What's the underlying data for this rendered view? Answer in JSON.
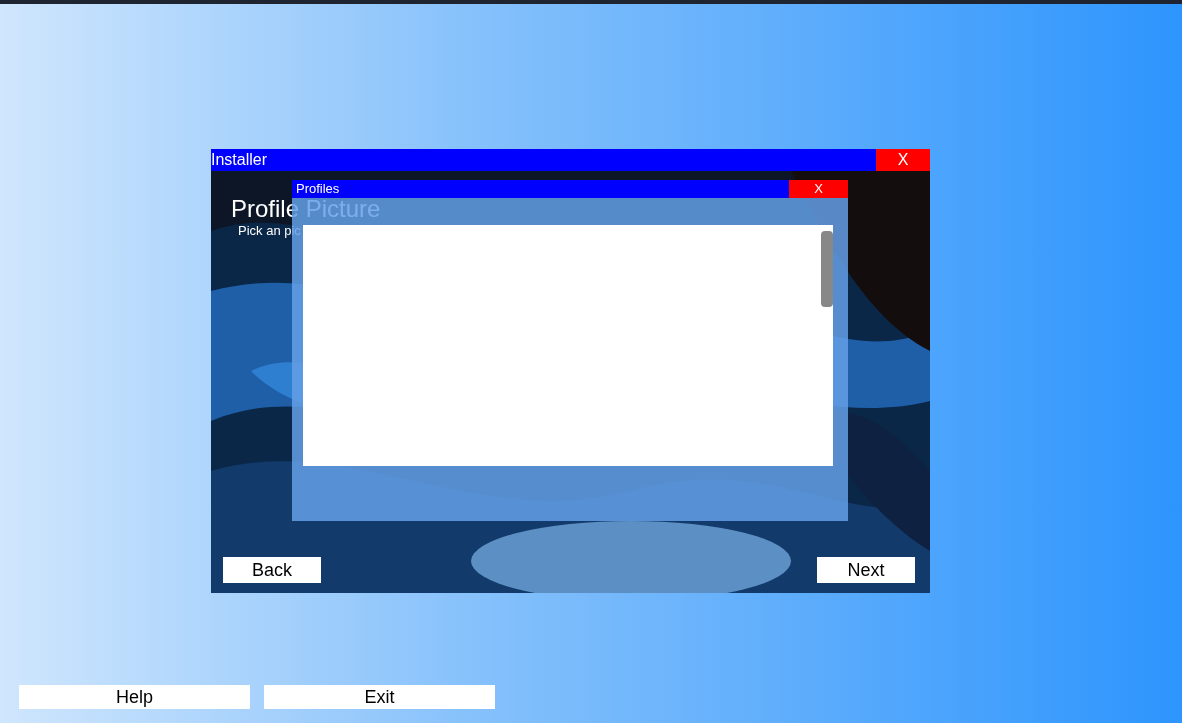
{
  "installer": {
    "title": "Installer",
    "close": "X",
    "heading": "Profile Picture",
    "subtitle": "Pick an pic",
    "buttons": [
      "Back",
      "Next"
    ]
  },
  "profiles": {
    "title": "Profiles",
    "close": "X"
  },
  "desktop_buttons": [
    "Help",
    "Exit"
  ]
}
